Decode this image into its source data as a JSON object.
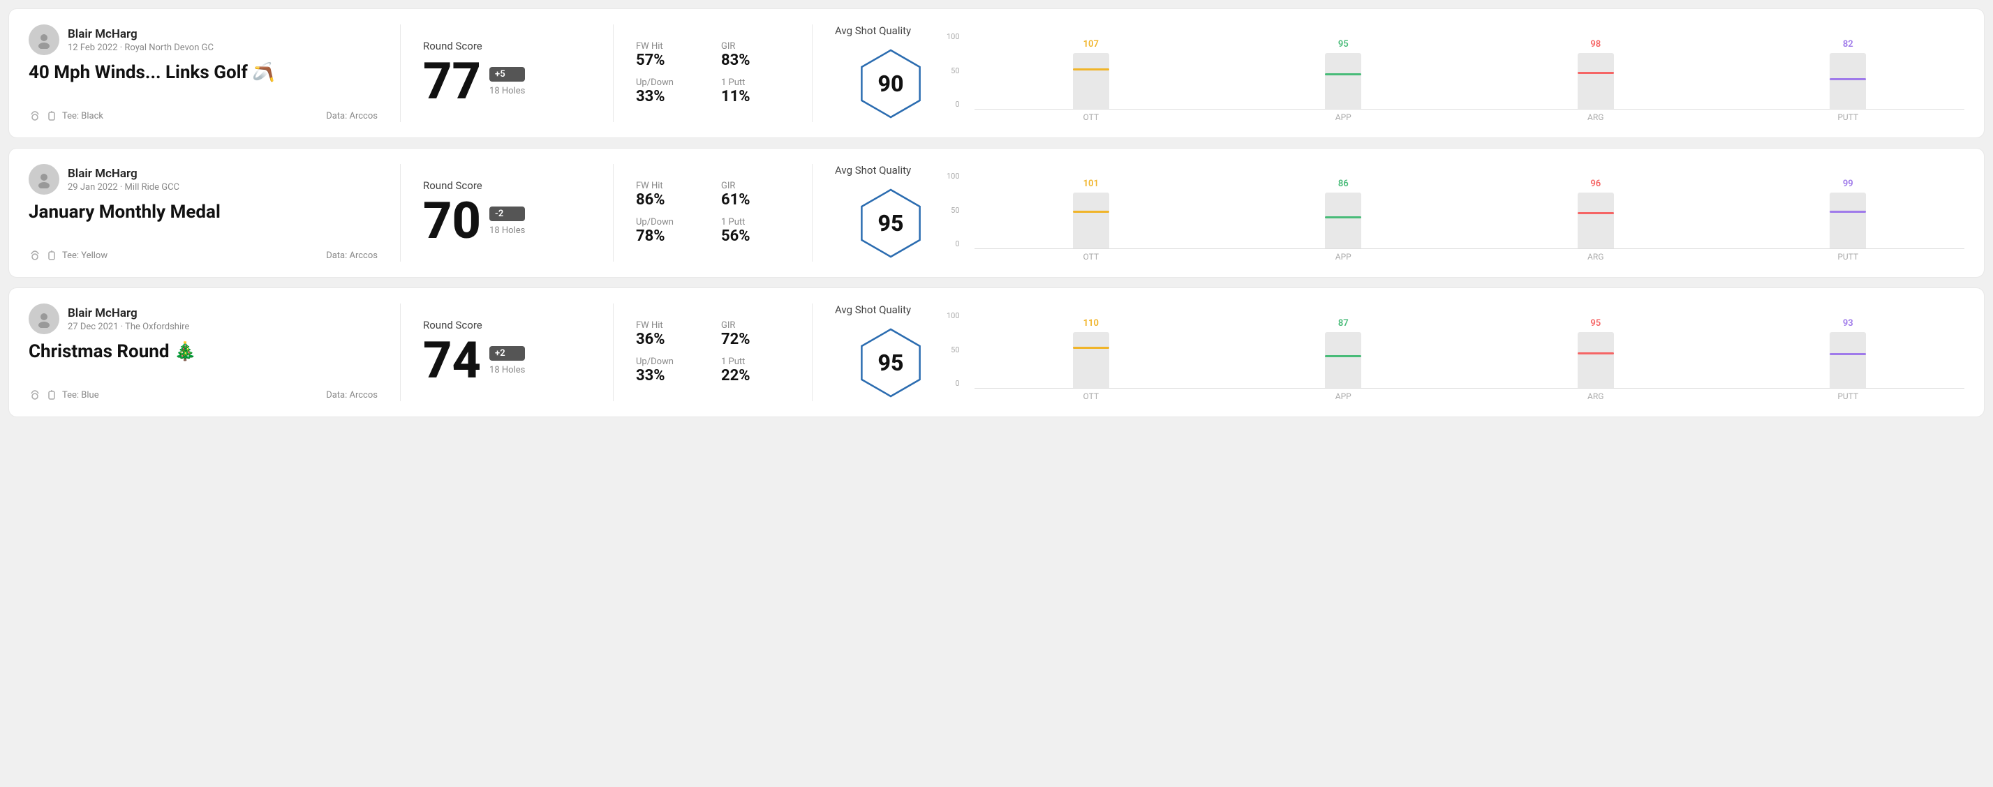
{
  "rounds": [
    {
      "id": "round-1",
      "user": {
        "name": "Blair McHarg",
        "date": "12 Feb 2022 · Royal North Devon GC"
      },
      "title": "40 Mph Winds... Links Golf 🪃",
      "tee": "Black",
      "data_source": "Data: Arccos",
      "score": {
        "label": "Round Score",
        "number": "77",
        "badge": "+5",
        "holes": "18 Holes"
      },
      "stats": {
        "fw_hit_label": "FW Hit",
        "fw_hit_value": "57%",
        "gir_label": "GIR",
        "gir_value": "83%",
        "updown_label": "Up/Down",
        "updown_value": "33%",
        "oneputt_label": "1 Putt",
        "oneputt_value": "11%"
      },
      "quality": {
        "label": "Avg Shot Quality",
        "score": "90"
      },
      "chart": {
        "bars": [
          {
            "label": "OTT",
            "value": 107,
            "color": "#f0b429",
            "height_pct": 0.72
          },
          {
            "label": "APP",
            "value": 95,
            "color": "#48bb78",
            "height_pct": 0.64
          },
          {
            "label": "ARG",
            "value": 98,
            "color": "#f56565",
            "height_pct": 0.66
          },
          {
            "label": "PUTT",
            "value": 82,
            "color": "#9f7aea",
            "height_pct": 0.55
          }
        ],
        "y_labels": [
          "100",
          "50",
          "0"
        ]
      }
    },
    {
      "id": "round-2",
      "user": {
        "name": "Blair McHarg",
        "date": "29 Jan 2022 · Mill Ride GCC"
      },
      "title": "January Monthly Medal",
      "tee": "Yellow",
      "data_source": "Data: Arccos",
      "score": {
        "label": "Round Score",
        "number": "70",
        "badge": "-2",
        "holes": "18 Holes"
      },
      "stats": {
        "fw_hit_label": "FW Hit",
        "fw_hit_value": "86%",
        "gir_label": "GIR",
        "gir_value": "61%",
        "updown_label": "Up/Down",
        "updown_value": "78%",
        "oneputt_label": "1 Putt",
        "oneputt_value": "56%"
      },
      "quality": {
        "label": "Avg Shot Quality",
        "score": "95"
      },
      "chart": {
        "bars": [
          {
            "label": "OTT",
            "value": 101,
            "color": "#f0b429",
            "height_pct": 0.68
          },
          {
            "label": "APP",
            "value": 86,
            "color": "#48bb78",
            "height_pct": 0.58
          },
          {
            "label": "ARG",
            "value": 96,
            "color": "#f56565",
            "height_pct": 0.65
          },
          {
            "label": "PUTT",
            "value": 99,
            "color": "#9f7aea",
            "height_pct": 0.67
          }
        ],
        "y_labels": [
          "100",
          "50",
          "0"
        ]
      }
    },
    {
      "id": "round-3",
      "user": {
        "name": "Blair McHarg",
        "date": "27 Dec 2021 · The Oxfordshire"
      },
      "title": "Christmas Round 🎄",
      "tee": "Blue",
      "data_source": "Data: Arccos",
      "score": {
        "label": "Round Score",
        "number": "74",
        "badge": "+2",
        "holes": "18 Holes"
      },
      "stats": {
        "fw_hit_label": "FW Hit",
        "fw_hit_value": "36%",
        "gir_label": "GIR",
        "gir_value": "72%",
        "updown_label": "Up/Down",
        "updown_value": "33%",
        "oneputt_label": "1 Putt",
        "oneputt_value": "22%"
      },
      "quality": {
        "label": "Avg Shot Quality",
        "score": "95"
      },
      "chart": {
        "bars": [
          {
            "label": "OTT",
            "value": 110,
            "color": "#f0b429",
            "height_pct": 0.74
          },
          {
            "label": "APP",
            "value": 87,
            "color": "#48bb78",
            "height_pct": 0.59
          },
          {
            "label": "ARG",
            "value": 95,
            "color": "#f56565",
            "height_pct": 0.64
          },
          {
            "label": "PUTT",
            "value": 93,
            "color": "#9f7aea",
            "height_pct": 0.63
          }
        ],
        "y_labels": [
          "100",
          "50",
          "0"
        ]
      }
    }
  ]
}
